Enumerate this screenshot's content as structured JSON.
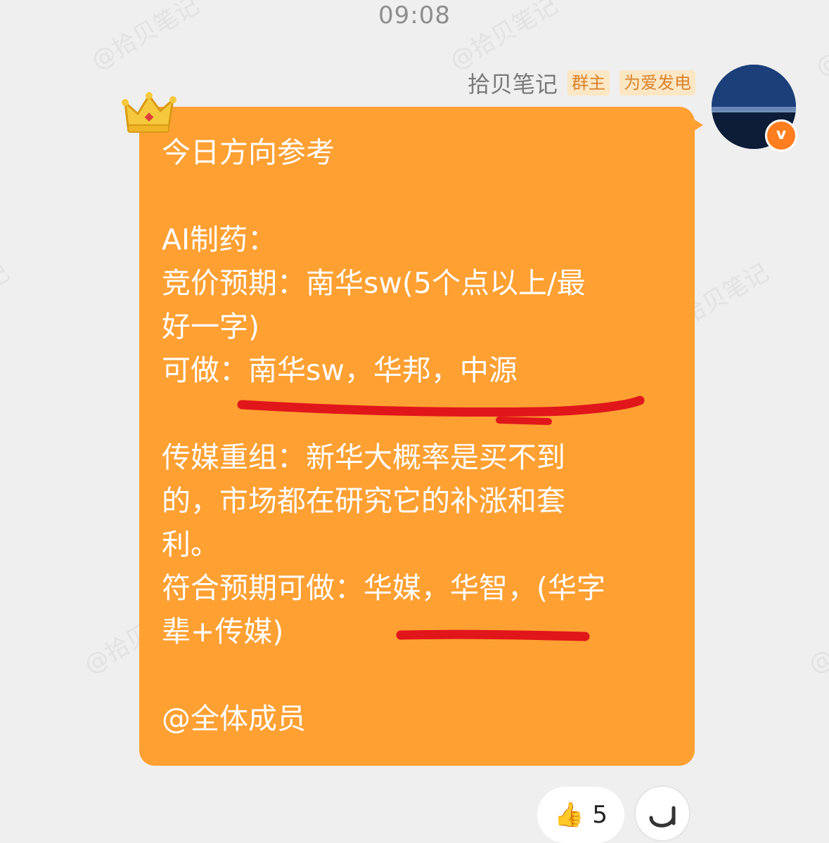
{
  "status": {
    "time": "09:08"
  },
  "watermark": "@拾贝笔记",
  "sender": {
    "name": "拾贝笔记",
    "role_tag": "群主",
    "badge_tag": "为爱发电",
    "verified_icon": "v-badge-icon"
  },
  "message": {
    "bubble_color": "#ffa033",
    "lines": [
      "今日方向参考",
      "",
      "AI制药：",
      "竞价预期：南华sw(5个点以上/最",
      "好一字)",
      "可做：南华sw，华邦，中源",
      "",
      "传媒重组：新华大概率是买不到",
      "的，市场都在研究它的补涨和套",
      "利。",
      "符合预期可做：华媒，华智，(华字",
      "辈+传媒)",
      "",
      "@全体成员"
    ]
  },
  "reactions": {
    "thumbs_up": {
      "icon": "thumbs-up-icon",
      "count": "5"
    },
    "add_icon": "add-reaction-icon"
  },
  "colors": {
    "underline": "#e0161a",
    "tag_text": "#d9822b",
    "verified": "#ff7e1f"
  }
}
